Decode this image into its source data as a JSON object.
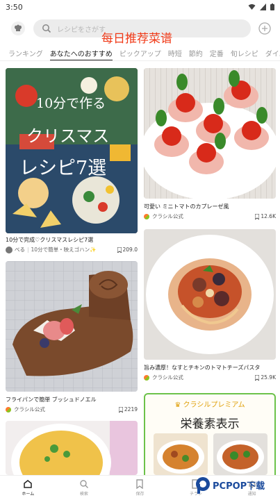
{
  "status_bar": {
    "time": "3:50"
  },
  "header": {
    "search_placeholder": "レシピをさがす",
    "overlay_title": "每日推荐菜谱"
  },
  "tabs": [
    {
      "label": "ランキング",
      "active": false
    },
    {
      "label": "あなたへのおすすめ",
      "active": true
    },
    {
      "label": "ピックアップ",
      "active": false
    },
    {
      "label": "時短",
      "active": false
    },
    {
      "label": "節約",
      "active": false
    },
    {
      "label": "定番",
      "active": false
    },
    {
      "label": "旬レシピ",
      "active": false
    },
    {
      "label": "ダイエット",
      "active": false
    }
  ],
  "cards": {
    "christmas": {
      "image_heading": "10分で作る",
      "image_title_1": "クリスマス",
      "image_title_2": "レシピ7選",
      "title": "10分で完成♡クリスマスレシピ7選",
      "author": "べる",
      "tagline": "10分で簡単・映えゴハン✨",
      "bookmarks": "209.0"
    },
    "caprese": {
      "title": "可愛い ミニトマトのカプレーゼ風",
      "author": "クラシル公式",
      "bookmarks": "12.6K"
    },
    "noel": {
      "title": "フライパンで簡単 ブッシュドノエル",
      "author": "クラシル公式",
      "bookmarks": "2219"
    },
    "pasta": {
      "title": "旨み濃厚！なすとチキンのトマトチーズパスタ",
      "author": "クラシル公式",
      "bookmarks": "25.9K"
    }
  },
  "premium": {
    "heading": "クラシルプレミアム",
    "title": "栄養素表示"
  },
  "bottom_nav": [
    {
      "label": "ホーム",
      "icon": "home-icon",
      "active": true
    },
    {
      "label": "検索",
      "icon": "search-icon",
      "active": false
    },
    {
      "label": "保存",
      "icon": "bookmark-icon",
      "active": false
    },
    {
      "label": "チラシ",
      "icon": "flyer-icon",
      "active": false
    },
    {
      "label": "通知",
      "icon": "bell-icon",
      "active": false
    }
  ],
  "watermark": {
    "text": "PCPOP下载"
  },
  "colors": {
    "accent_green": "#6cc24a",
    "premium_gold": "#e0a10c",
    "overlay_red": "#f03a18"
  }
}
